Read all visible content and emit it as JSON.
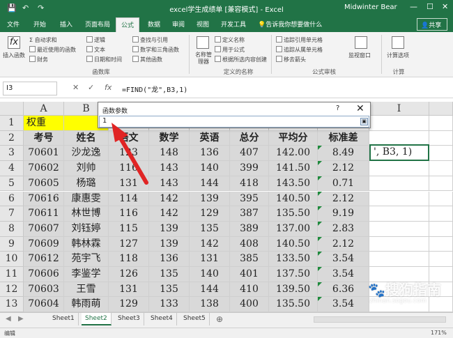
{
  "titlebar": {
    "title": "excel学生成绩单 [兼容模式] - Excel",
    "user": "Midwinter Bear",
    "save_icon": "💾",
    "undo_icon": "↶",
    "redo_icon": "↷",
    "min_icon": "—",
    "max_icon": "☐",
    "close_icon": "✕"
  },
  "ribbon_tabs": [
    "文件",
    "开始",
    "插入",
    "页面布局",
    "公式",
    "数据",
    "审阅",
    "视图",
    "开发工具"
  ],
  "tell_me": "告诉我你想要做什么",
  "share": "共享",
  "ribbon": {
    "insert_function": "插入函数",
    "autosum": "自动求和",
    "recent": "最近使用的函数",
    "financial": "财务",
    "logical": "逻辑",
    "text": "文本",
    "datetime": "日期和时间",
    "lookup": "查找与引用",
    "math": "数学和三角函数",
    "other": "其他函数",
    "name_manager": "名称管理器",
    "define_name": "定义名称",
    "use_in_formula": "用于公式",
    "create_from_selection": "根据所选内容创建",
    "trace_precedents": "追踪引用单元格",
    "trace_dependents": "追踪从属单元格",
    "remove_arrows": "移去箭头",
    "watch_window": "监视窗口",
    "calc_options": "计算选项",
    "group_library": "函数库",
    "group_names": "定义的名称",
    "group_auditing": "公式审核",
    "group_calc": "计算"
  },
  "formula_bar": {
    "name_box": "I3",
    "cancel": "✕",
    "enter": "✓",
    "fx": "fx",
    "formula": "=FIND(\"龙\",B3,1)"
  },
  "columns": [
    "A",
    "B",
    "C",
    "D",
    "E",
    "F",
    "G",
    "H",
    "I"
  ],
  "rows": [
    "1",
    "2",
    "3",
    "4",
    "5",
    "6",
    "7",
    "8",
    "9",
    "10",
    "11",
    "12",
    "13"
  ],
  "sheet": {
    "r1_label": "权重",
    "headers": [
      "考号",
      "姓名",
      "语文",
      "数学",
      "英语",
      "总分",
      "平均分",
      "标准差"
    ],
    "data": [
      [
        "70601",
        "沙龙逸",
        "123",
        "148",
        "136",
        "407",
        "142.00",
        "8.49"
      ],
      [
        "70602",
        "刘帅",
        "116",
        "143",
        "140",
        "399",
        "141.50",
        "2.12"
      ],
      [
        "70605",
        "杨璐",
        "131",
        "143",
        "144",
        "418",
        "143.50",
        "0.71"
      ],
      [
        "70616",
        "康惠雯",
        "114",
        "142",
        "139",
        "395",
        "140.50",
        "2.12"
      ],
      [
        "70611",
        "林世博",
        "116",
        "142",
        "129",
        "387",
        "135.50",
        "9.19"
      ],
      [
        "70607",
        "刘钰婷",
        "115",
        "139",
        "135",
        "389",
        "137.00",
        "2.83"
      ],
      [
        "70609",
        "韩林霖",
        "127",
        "139",
        "142",
        "408",
        "140.50",
        "2.12"
      ],
      [
        "70612",
        "苑宇飞",
        "118",
        "136",
        "131",
        "385",
        "133.50",
        "3.54"
      ],
      [
        "70606",
        "李鉴学",
        "126",
        "135",
        "140",
        "401",
        "137.50",
        "3.54"
      ],
      [
        "70603",
        "王雪",
        "131",
        "135",
        "144",
        "410",
        "139.50",
        "6.36"
      ],
      [
        "70604",
        "韩雨萌",
        "129",
        "133",
        "138",
        "400",
        "135.50",
        "3.54"
      ]
    ],
    "edit_text": "', B3, 1)"
  },
  "dialog": {
    "title": "函数参数",
    "help": "?",
    "close": "✕",
    "input_value": "1"
  },
  "sheet_tabs": [
    "Sheet1",
    "Sheet2",
    "Sheet3",
    "Sheet4",
    "Sheet5"
  ],
  "status": {
    "mode": "编辑",
    "zoom": "171%"
  },
  "watermark": {
    "main": "搜狗指南",
    "sub": "zhinan.sogou.com"
  }
}
